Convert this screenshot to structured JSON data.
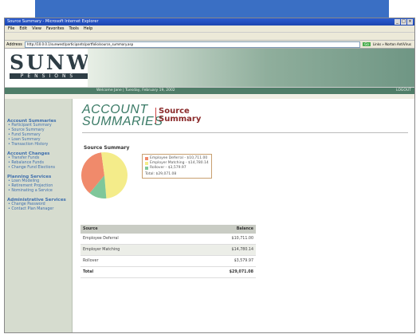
{
  "window": {
    "title": "Source Summary - Microsoft Internet Explorer",
    "controls": [
      "_",
      "□",
      "×"
    ]
  },
  "menu": [
    "File",
    "Edit",
    "View",
    "Favorites",
    "Tools",
    "Help"
  ],
  "address": {
    "label": "Address",
    "url": "http://10.0.0.1/sunwest/participants/portfolio/source_summary.asp",
    "go_label": "Go",
    "links_label": "Links » Norton AntiVirus"
  },
  "brand": {
    "name": "SUNWEST",
    "tagline": "PENSIONS"
  },
  "header": {
    "welcome": "Welcome Jane  |  Tuesday, February 19, 2002",
    "logout": "LOGOUT"
  },
  "sidebar": {
    "sections": [
      {
        "title": "Account Summaries",
        "items": [
          "Participant Summary",
          "Source Summary",
          "Fund Summary",
          "Loan Summary",
          "Transaction History"
        ]
      },
      {
        "title": "Account Changes",
        "items": [
          "Transfer Funds",
          "Rebalance Funds",
          "Change Fund Elections"
        ]
      },
      {
        "title": "Planning Services",
        "items": [
          "Loan Modeling",
          "Retirement Projection",
          "Nominating a Service"
        ]
      },
      {
        "title": "Administrative Services",
        "items": [
          "Change Password",
          "Contact Plan Manager"
        ]
      }
    ]
  },
  "page": {
    "section_line1": "ACCOUNT",
    "section_line2": "SUMMARIES",
    "title_line1": "Source",
    "title_line2": "Summary"
  },
  "chart_data": {
    "type": "pie",
    "title": "Source Summary",
    "slices": [
      {
        "name": "Employee Deferral",
        "value": 10711.0,
        "label": "Employee Deferral - $10,711.00",
        "color": "#f08a6b"
      },
      {
        "name": "Employer Matching",
        "value": 14780.14,
        "label": "Employer Matching - $14,780.14",
        "color": "#f4ec8a"
      },
      {
        "name": "Rollover",
        "value": 3579.97,
        "label": "Rollover - $3,579.97",
        "color": "#7fc79a"
      }
    ],
    "total_label": "Total: $29,071.08",
    "legend": "right"
  },
  "table": {
    "headers": [
      "Source",
      "Balance"
    ],
    "rows": [
      [
        "Employee Deferral",
        "$10,711.00"
      ],
      [
        "Employer Matching",
        "$14,780.14"
      ],
      [
        "Rollover",
        "$3,579.97"
      ]
    ],
    "total": [
      "Total",
      "$29,071.08"
    ]
  }
}
